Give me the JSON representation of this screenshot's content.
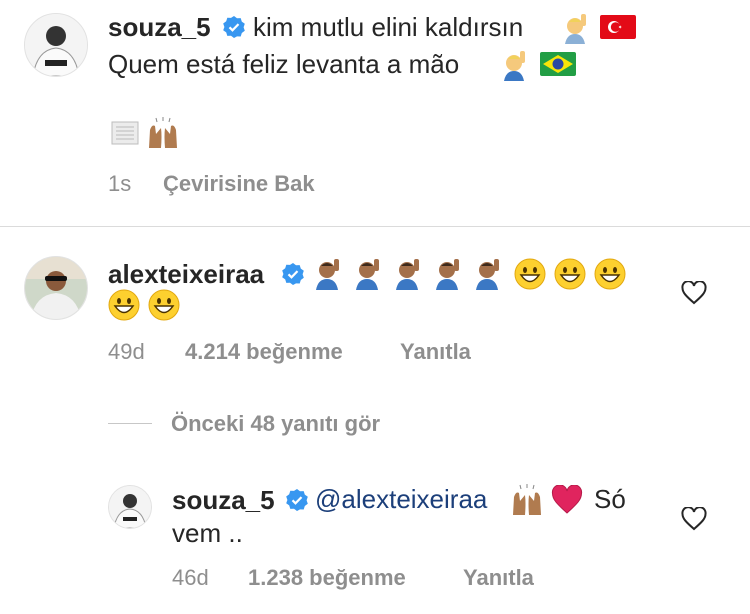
{
  "comment1": {
    "username": "souza_5",
    "line1": "kim mutlu elini kaldırsın",
    "line2": "Quem está feliz levanta a mão",
    "time": "1s",
    "translate": "Çevirisine Bak"
  },
  "comment2": {
    "username": "alexteixeiraa",
    "time": "49d",
    "likes": "4.214 beğenme",
    "reply": "Yanıtla"
  },
  "view_replies": "Önceki 48 yanıtı gör",
  "reply1": {
    "username": "souza_5",
    "mention": "@alexteixeiraa",
    "text_tail": "Só",
    "text_line2": "vem ..",
    "time": "46d",
    "likes": "1.238 beğenme",
    "reply": "Yanıtla"
  },
  "colors": {
    "verified": "#3897f0",
    "mention": "#1c3f7a",
    "meta": "#8e8e8e",
    "heart": "#e0245e"
  }
}
